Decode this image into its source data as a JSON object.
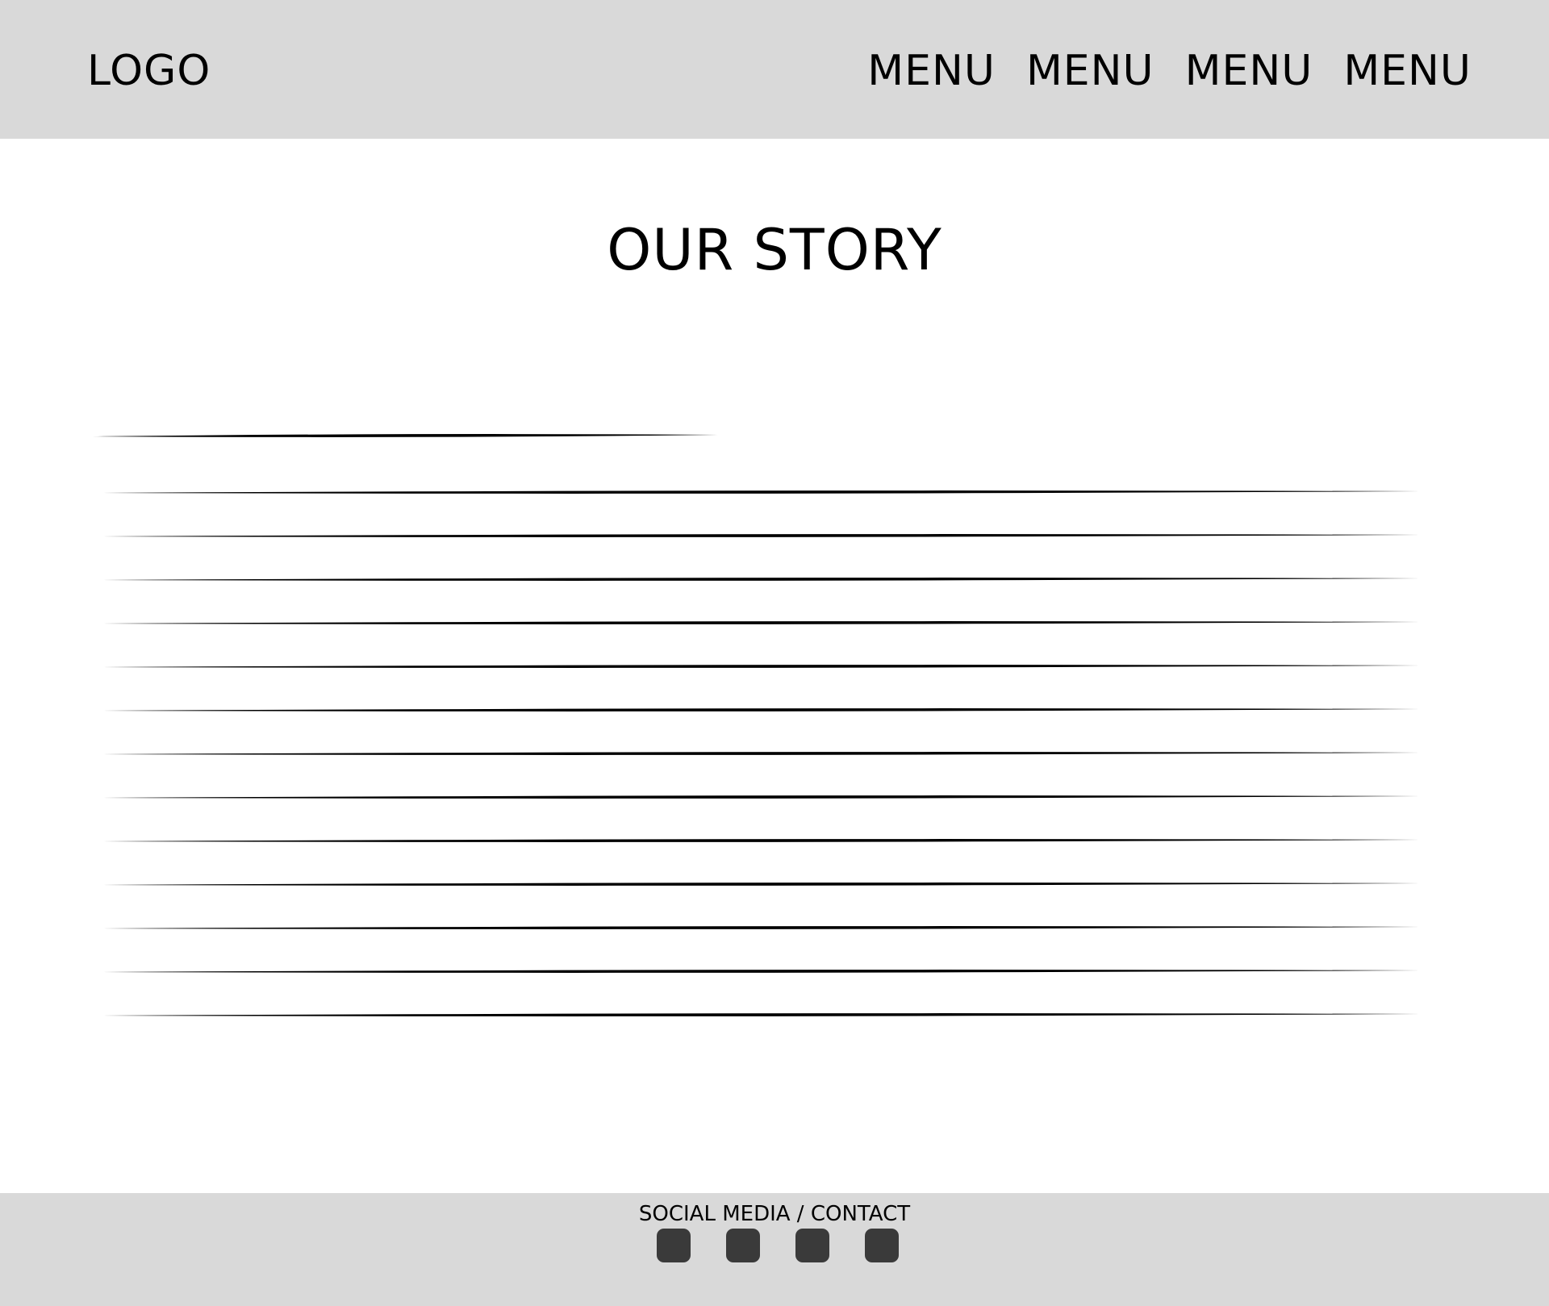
{
  "header": {
    "logo": "LOGO",
    "menu": [
      {
        "label": "MENU"
      },
      {
        "label": "MENU"
      },
      {
        "label": "MENU"
      },
      {
        "label": "MENU"
      }
    ]
  },
  "main": {
    "title": "OUR STORY",
    "placeholder_line_count": 14
  },
  "footer": {
    "label": "SOCIAL MEDIA / CONTACT",
    "social_icons": [
      "social-icon",
      "social-icon",
      "social-icon",
      "social-icon"
    ]
  },
  "colors": {
    "header_bg": "#d9d9d9",
    "footer_bg": "#d9d9d9",
    "icon": "#3a3a3a",
    "text": "#000000"
  }
}
